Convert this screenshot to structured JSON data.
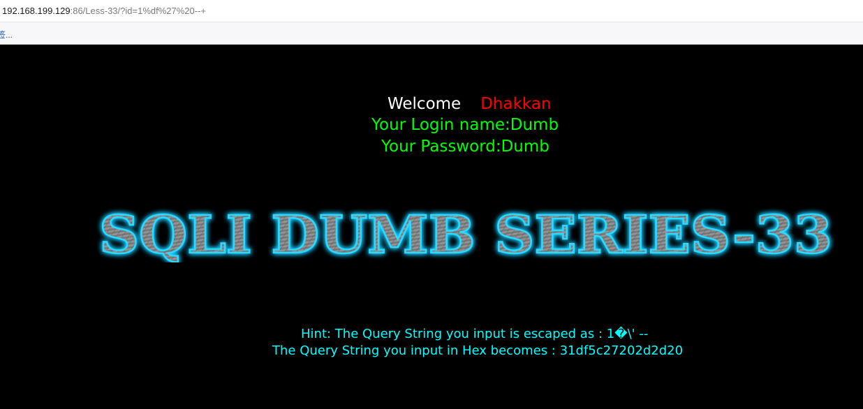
{
  "browser": {
    "url_host": "192.168.199.129",
    "url_rest": ":86/Less-33/?id=1%df%27%20--+",
    "bookmark_label": "签..."
  },
  "page": {
    "welcome_word": "Welcome",
    "welcome_name": "Dhakkan",
    "login_line": "Your Login name:Dumb",
    "password_line": "Your Password:Dumb",
    "banner_title": "SQLI DUMB SERIES-33",
    "hint_line": "Hint: The Query String you input is escaped as : 1�\\' --",
    "hex_line": "The Query String you input in Hex becomes : 31df5c27202d2d20"
  },
  "colors": {
    "background": "#000000",
    "welcome_word": "#ffffff",
    "welcome_name": "#ff0000",
    "credentials": "#00ff00",
    "hint": "#00ffff",
    "banner_glow": "#19c8ff",
    "banner_fill": "#8a8a8a"
  }
}
